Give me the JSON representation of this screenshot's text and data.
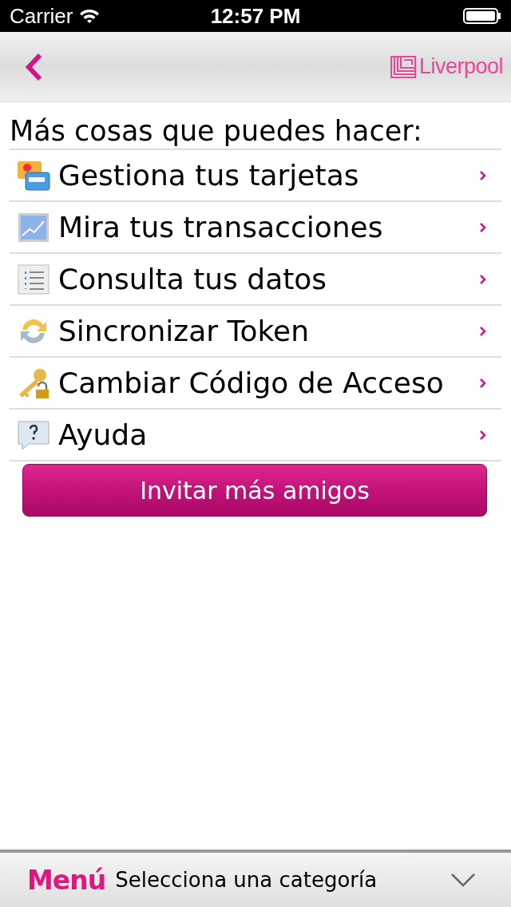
{
  "status_bar": {
    "carrier": "Carrier",
    "time": "12:57 PM"
  },
  "nav_bar": {
    "logo": "Liverpool"
  },
  "heading": "Más cosas que puedes hacer:",
  "items": [
    {
      "kind": "cards",
      "label": "Gestiona tus tarjetas"
    },
    {
      "kind": "chart",
      "label": "Mira tus transacciones"
    },
    {
      "kind": "list",
      "label": "Consulta tus datos"
    },
    {
      "kind": "sync",
      "label": "Sincronizar Token"
    },
    {
      "kind": "key",
      "label": "Cambiar Código de Acceso"
    },
    {
      "kind": "help",
      "label": "Ayuda"
    }
  ],
  "invite_button": "Invitar más amigos",
  "bottom_bar": {
    "title": "Menú",
    "prompt": "Selecciona una categoría"
  }
}
